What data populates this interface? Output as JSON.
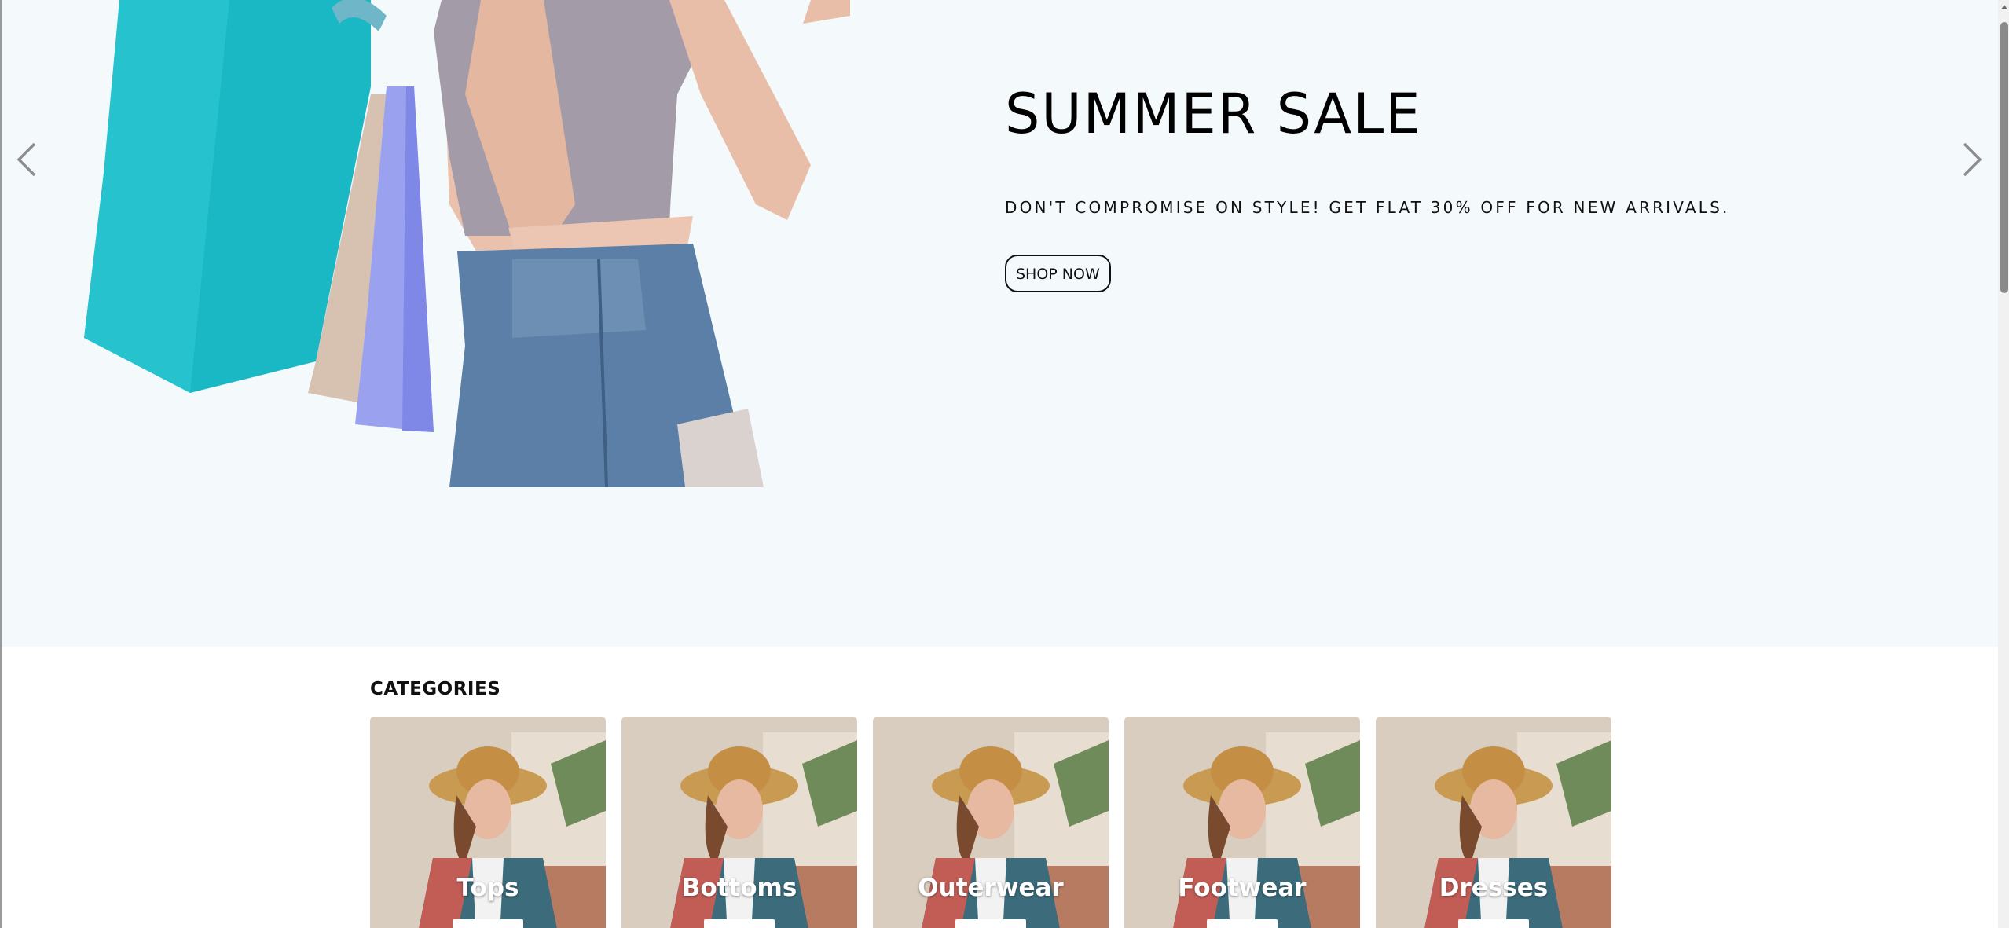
{
  "hero": {
    "title": "SUMMER SALE",
    "subtitle": "DON'T COMPROMISE ON STYLE! GET FLAT 30% OFF FOR NEW ARRIVALS.",
    "button_label": "SHOP NOW",
    "prev_icon": "chevron-left-icon",
    "next_icon": "chevron-right-icon",
    "background_color": "#f4f9fc"
  },
  "categories": {
    "heading": "CATEGORIES",
    "items": [
      {
        "label": "Tops"
      },
      {
        "label": "Bottoms"
      },
      {
        "label": "Outerwear"
      },
      {
        "label": "Footwear"
      },
      {
        "label": "Dresses"
      }
    ]
  }
}
